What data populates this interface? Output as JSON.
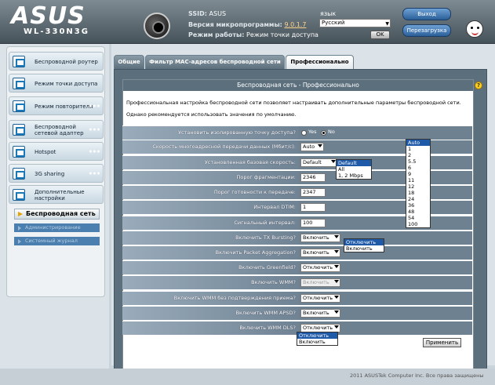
{
  "header": {
    "logo": "ASUS",
    "model": "WL-330N3G",
    "ssid_label": "SSID:",
    "ssid_value": "ASUS",
    "firmware_label": "Версия микропрограммы:",
    "firmware_value": "9.0.1.7",
    "mode_label": "Режим работы:",
    "mode_value": "Режим точки доступа",
    "language_label": "язык",
    "language_value": "Русский",
    "ok_label": "OK",
    "logout_label": "Выход",
    "reboot_label": "Перезагрузка"
  },
  "sidebar": {
    "items": [
      {
        "label": "Беспроводной роутер"
      },
      {
        "label": "Режим точки доступа"
      },
      {
        "label": "Режим повторителя"
      },
      {
        "label": "Беспроводной сетевой адаптер"
      },
      {
        "label": "Hotspot"
      },
      {
        "label": "3G sharing"
      },
      {
        "label": "Дополнительные настройки"
      }
    ],
    "submenu": [
      {
        "label": "Беспроводная сеть"
      },
      {
        "label": "Администрирование"
      },
      {
        "label": "Системный журнал"
      }
    ]
  },
  "tabs": [
    {
      "label": "Общие"
    },
    {
      "label": "Фильтр MAC-адресов беспроводной сети"
    },
    {
      "label": "Профессионально"
    }
  ],
  "content": {
    "title": "Беспроводная сеть - Профессионально",
    "desc1": "Профессиональная настройка беспроводной сети позволяет настраивать дополнительные параметры беспроводной сети.",
    "desc2": "Однако рекомендуется использовать значения по умолчанию.",
    "apply_label": "Применить"
  },
  "form": {
    "ap_isolate": {
      "label": "Установить изолированную точку доступа?",
      "yes": "Yes",
      "no": "No",
      "selected": "No"
    },
    "mcast_rate": {
      "label": "Скорость многоадресной передачи данных (Мбит/с):",
      "value": "Auto",
      "options": [
        "Auto",
        "1",
        "2",
        "5.5",
        "6",
        "9",
        "11",
        "12",
        "18",
        "24",
        "36",
        "48",
        "54",
        "100"
      ]
    },
    "basic_rate": {
      "label": "Установленная базовая скорость:",
      "value": "Default",
      "options": [
        "Default",
        "All",
        "1, 2 Mbps"
      ]
    },
    "frag": {
      "label": "Порог фрагментации:",
      "value": "2346"
    },
    "rts": {
      "label": "Порог готовности к передаче:",
      "value": "2347"
    },
    "dtim": {
      "label": "Интервал DTIM:",
      "value": "1"
    },
    "beacon": {
      "label": "Сигнальный интервал:",
      "value": "100"
    },
    "tx_burst": {
      "label": "Включить TX Bursting?",
      "value": "Включить",
      "options": [
        "Отключить",
        "Включить"
      ]
    },
    "pkt_agg": {
      "label": "Включить Packet Aggregation?",
      "value": "Включить"
    },
    "greenfield": {
      "label": "Включить Greenfield?",
      "value": "Отключить"
    },
    "wmm": {
      "label": "Включить WMM?",
      "value": "Включить"
    },
    "wmm_noack": {
      "label": "Включить WMM без подтверждения приема?",
      "value": "Отключить"
    },
    "wmm_apsd": {
      "label": "Включить WMM APSD?",
      "value": "Включить"
    },
    "wmm_dls": {
      "label": "Включить WMM DLS?",
      "value": "Отключить",
      "options": [
        "Отключить",
        "Включить"
      ]
    }
  },
  "footer": {
    "copyright": "2011 ASUSTek Computer Inc. Все права защищены"
  }
}
